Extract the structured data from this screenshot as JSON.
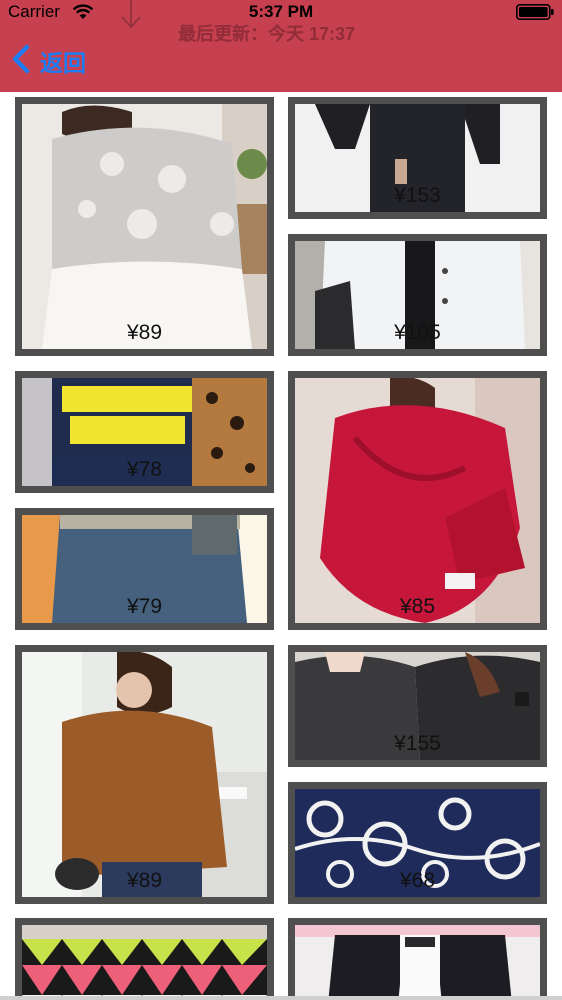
{
  "status_bar": {
    "carrier": "Carrier",
    "time": "5:37 PM"
  },
  "refresh": {
    "last_updated": "最后更新：今天 17:37"
  },
  "nav": {
    "back_label": "返回",
    "accent_color": "#1c7df7",
    "bar_color": "#c6404f"
  },
  "items": [
    {
      "price": "¥89",
      "image": "white-lace-sweater-dress"
    },
    {
      "price": "¥153",
      "image": "black-dress-cardigan"
    },
    {
      "price": "¥105",
      "image": "white-shirt-black-tie"
    },
    {
      "price": "¥78",
      "image": "yellow-nobody-knows-sweatshirt"
    },
    {
      "price": "¥85",
      "image": "red-knit-sweater"
    },
    {
      "price": "¥79",
      "image": "blue-knit-skirt"
    },
    {
      "price": "¥89",
      "image": "brown-knit-pullover"
    },
    {
      "price": "¥155",
      "image": "dark-grey-knit-sweater"
    },
    {
      "price": "¥68",
      "image": "navy-paisley-sweater"
    },
    {
      "price": "",
      "image": "pink-black-zigzag-sweater"
    },
    {
      "price": "",
      "image": "white-shirt-black-jacket"
    }
  ]
}
